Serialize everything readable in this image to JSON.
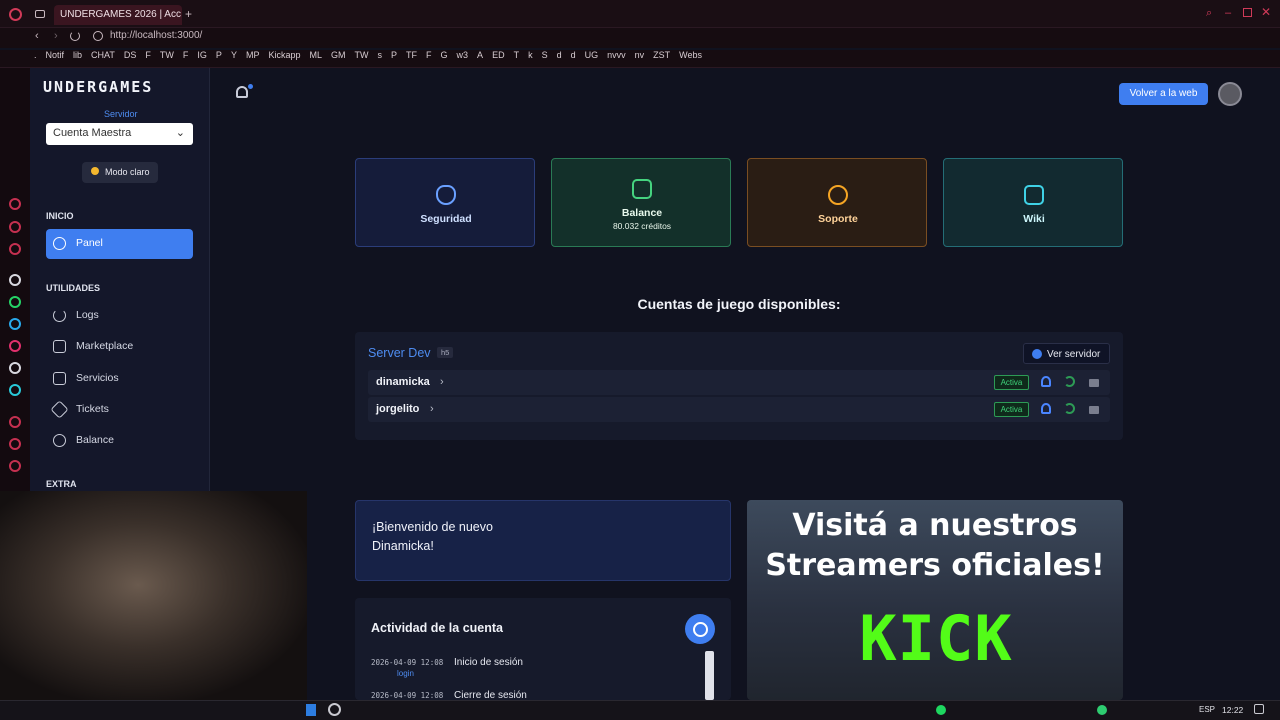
{
  "browser": {
    "tab_title": "UNDERGAMES 2026 | Acc",
    "url": "http://localhost:3000/",
    "bookmarks": [
      ".",
      "Notif",
      "lib",
      "CHAT",
      "DS",
      "F",
      "TW",
      "F",
      "IG",
      "P",
      "Y",
      "MP",
      "Kickapp",
      "ML",
      "GM",
      "TW",
      "s",
      "P",
      "TF",
      "F",
      "G",
      "w3",
      "A",
      "ED",
      "T",
      "k",
      "S",
      "d",
      "d",
      "UG",
      "nvvv",
      "nv",
      "ZST",
      "Webs"
    ]
  },
  "sidebar": {
    "logo": "UNDERGAMES",
    "server_label": "Servidor",
    "server_value": "Cuenta Maestra",
    "theme_toggle": "Modo claro",
    "sections": {
      "inicio": "INICIO",
      "utilidades": "UTILIDADES",
      "extra": "EXTRA"
    },
    "items": [
      {
        "label": "Panel",
        "icon": "palette-icon"
      },
      {
        "label": "Logs",
        "icon": "refresh-icon"
      },
      {
        "label": "Marketplace",
        "icon": "cart-icon"
      },
      {
        "label": "Servicios",
        "icon": "server-icon"
      },
      {
        "label": "Tickets",
        "icon": "ticket-icon"
      },
      {
        "label": "Balance",
        "icon": "dollar-icon"
      }
    ]
  },
  "header": {
    "website_button": "Volver a la web"
  },
  "quick_cards": [
    {
      "title": "Seguridad",
      "icon": "shield-icon",
      "color": "#6aa0ff"
    },
    {
      "title": "Balance",
      "subtitle": "80.032 créditos",
      "icon": "wallet-icon",
      "color": "#45d37f"
    },
    {
      "title": "Soporte",
      "icon": "headset-icon",
      "color": "#f5a524"
    },
    {
      "title": "Wiki",
      "icon": "book-icon",
      "color": "#3fd2e6"
    }
  ],
  "accounts": {
    "title": "Cuentas de juego disponibles:",
    "server_name": "Server Dev",
    "server_tag": "h5",
    "view_server_button": "Ver servidor",
    "rows": [
      {
        "name": "dinamicka",
        "status": "Activa"
      },
      {
        "name": "jorgelito",
        "status": "Activa"
      }
    ]
  },
  "welcome": {
    "line1": "¡Bienvenido de nuevo",
    "line2": "Dinamicka!"
  },
  "activity": {
    "title": "Actividad de la cuenta",
    "entries": [
      {
        "date": "2026-04-09 12:08",
        "text": "Inicio de sesión",
        "type": "login"
      },
      {
        "date": "2026-04-09 12:08",
        "text": "Cierre de sesión",
        "type": ""
      }
    ]
  },
  "banner": {
    "line1": "Visitá a nuestros",
    "line2": "Streamers oficiales!",
    "brand": "KICK"
  },
  "taskbar": {
    "language": "ESP",
    "time": "12:22"
  },
  "colors": {
    "accent": "#3f7ef0",
    "active_badge": "#3fd27a",
    "kick_green": "#53fc18"
  }
}
